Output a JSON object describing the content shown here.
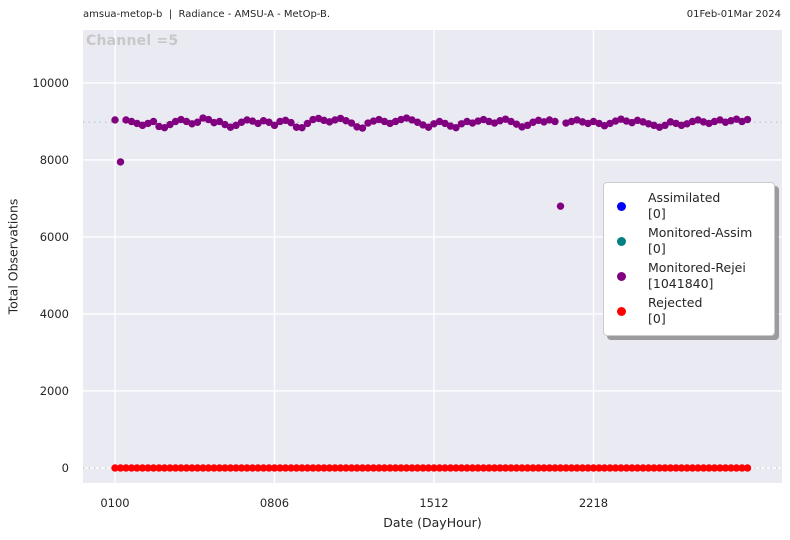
{
  "header": {
    "left_title": "amsua-metop-b  |  Radiance - AMSU-A - MetOp-B.",
    "right_date_range": "01Feb-01Mar 2024"
  },
  "chart_data": {
    "type": "scatter",
    "title": "Channel =5",
    "xlabel": "Date (DayHour)",
    "ylabel": "Total Observations",
    "x_tick_labels": [
      "0100",
      "0806",
      "1512",
      "2218"
    ],
    "x_tick_indices": [
      0,
      29,
      58,
      87
    ],
    "n_points": 116,
    "y_ticks": [
      0,
      2000,
      4000,
      6000,
      8000,
      10000
    ],
    "ylim": [
      -390,
      11376
    ],
    "grid": true,
    "legend_position": "center right",
    "ref_lines": [
      8980,
      0
    ],
    "series": [
      {
        "name": "Assimilated",
        "count": 0,
        "color": "#0000ff",
        "values": []
      },
      {
        "name": "Monitored-Assim",
        "count": 0,
        "color": "#008080",
        "values": []
      },
      {
        "name": "Monitored-Rejei",
        "count": 1041840,
        "color": "#800080",
        "values": [
          9040,
          7950,
          9040,
          9000,
          8950,
          8900,
          8950,
          9000,
          8870,
          8840,
          8920,
          9000,
          9050,
          9000,
          8940,
          8980,
          9090,
          9050,
          8970,
          9000,
          8920,
          8850,
          8900,
          8980,
          9040,
          9010,
          8950,
          9020,
          8980,
          8900,
          9000,
          9030,
          8970,
          8850,
          8840,
          8950,
          9050,
          9080,
          9030,
          8990,
          9040,
          9080,
          9020,
          8960,
          8860,
          8830,
          8960,
          9010,
          9050,
          9000,
          8950,
          9000,
          9050,
          9090,
          9040,
          8980,
          8910,
          8850,
          8940,
          9000,
          8950,
          8880,
          8840,
          8940,
          9000,
          8960,
          9010,
          9050,
          9000,
          8960,
          9020,
          9060,
          9000,
          8930,
          8860,
          8900,
          8980,
          9030,
          8990,
          9040,
          9000,
          6800,
          8960,
          9000,
          9040,
          8990,
          8950,
          9000,
          8950,
          8890,
          8950,
          9010,
          9060,
          9010,
          8970,
          9030,
          8990,
          8940,
          8900,
          8850,
          8900,
          8990,
          8950,
          8900,
          8940,
          9000,
          9040,
          8990,
          8950,
          9000,
          9040,
          8980,
          9020,
          9060,
          9000,
          9050
        ]
      },
      {
        "name": "Rejected",
        "count": 0,
        "color": "#ff0000",
        "values": [
          0,
          0,
          0,
          0,
          0,
          0,
          0,
          0,
          0,
          0,
          0,
          0,
          0,
          0,
          0,
          0,
          0,
          0,
          0,
          0,
          0,
          0,
          0,
          0,
          0,
          0,
          0,
          0,
          0,
          0,
          0,
          0,
          0,
          0,
          0,
          0,
          0,
          0,
          0,
          0,
          0,
          0,
          0,
          0,
          0,
          0,
          0,
          0,
          0,
          0,
          0,
          0,
          0,
          0,
          0,
          0,
          0,
          0,
          0,
          0,
          0,
          0,
          0,
          0,
          0,
          0,
          0,
          0,
          0,
          0,
          0,
          0,
          0,
          0,
          0,
          0,
          0,
          0,
          0,
          0,
          0,
          0,
          0,
          0,
          0,
          0,
          0,
          0,
          0,
          0,
          0,
          0,
          0,
          0,
          0,
          0,
          0,
          0,
          0,
          0,
          0,
          0,
          0,
          0,
          0,
          0,
          0,
          0,
          0,
          0,
          0,
          0,
          0,
          0,
          0,
          0
        ]
      }
    ]
  },
  "legend": {
    "items": [
      {
        "label": "Assimilated",
        "count": "[0]",
        "color": "#0000ff"
      },
      {
        "label": "Monitored-Assim",
        "count": "[0]",
        "color": "#008080"
      },
      {
        "label": "Monitored-Rejei",
        "count": "[1041840]",
        "color": "#800080"
      },
      {
        "label": "Rejected",
        "count": "[0]",
        "color": "#ff0000"
      }
    ]
  },
  "colors": {
    "plot_bg": "#eaeaf2",
    "grid": "#ffffff",
    "ref_line": "#c9c9d2",
    "watermark": "#c8c8c8",
    "text": "#262626"
  }
}
